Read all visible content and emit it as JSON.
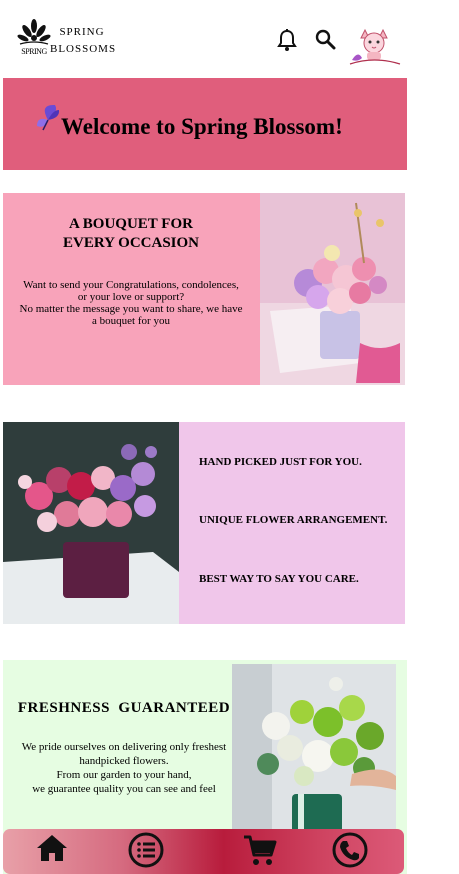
{
  "header": {
    "logo_icon": "lotus-logo-icon",
    "logo_text": "SPRING",
    "brand_line1": "SPRING",
    "brand_line2": "BLOSSOMS",
    "bell_icon": "bell-icon",
    "search_icon": "search-icon",
    "avatar_icon": "cat-avatar-icon"
  },
  "welcome": {
    "icon": "butterfly-icon",
    "text": "Welcome to Spring Blossom!",
    "bg": "#e05e7c"
  },
  "bouquet": {
    "heading_line1": "A BOUQUET FOR",
    "heading_line2": "EVERY OCCASION",
    "body_line1": "Want to send your Congratulations, condolences,",
    "body_line2": "or your love or support?",
    "body_line3": "No matter the message you want to share, we have",
    "body_line4": "a bouquet for you",
    "bg": "#f8a3ba"
  },
  "picked": {
    "items": [
      "HAND PICKED JUST FOR YOU.",
      "UNIQUE FLOWER ARRANGEMENT.",
      "BEST WAY TO SAY YOU CARE."
    ],
    "bg": "#f0c6ea"
  },
  "fresh": {
    "heading": "FRESHNESS  GUARANTEED",
    "body_line1": "We pride ourselves on delivering only freshest",
    "body_line2": "handpicked flowers.",
    "body_line3": "From our garden to your hand,",
    "body_line4": "we guarantee quality you can see and feel",
    "bg": "#e6fde2"
  },
  "nav": {
    "icons": [
      "home-icon",
      "menu-list-icon",
      "cart-icon",
      "phone-icon"
    ]
  }
}
